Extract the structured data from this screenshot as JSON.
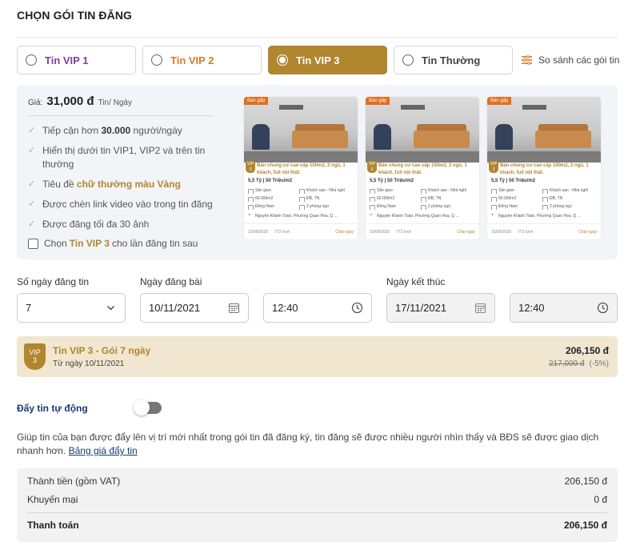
{
  "page": {
    "title": "CHỌN GÓI TIN ĐĂNG"
  },
  "tabs": [
    {
      "label": "Tin VIP 1",
      "color": "#7b3f98",
      "selected": false
    },
    {
      "label": "Tin VIP 2",
      "color": "#d9792e",
      "selected": false
    },
    {
      "label": "Tin VIP 3",
      "color": "#ffffff",
      "selected": true
    },
    {
      "label": "Tin Thường",
      "color": "#444444",
      "selected": false
    }
  ],
  "compare": {
    "label": "So sánh các gói tin",
    "icon": "sliders-icon"
  },
  "info": {
    "price_label": "Giá:",
    "price": "31,000 đ",
    "price_unit": "Tin/ Ngày",
    "features": [
      {
        "pre": "Tiếp cận hơn ",
        "bold": "30.000",
        "post": " người/ngày",
        "style": "bold"
      },
      {
        "pre": "Hiển thị dưới tin VIP1, VIP2 và trên tin thường",
        "bold": "",
        "post": "",
        "style": "plain"
      },
      {
        "pre": "Tiêu đề ",
        "bold": "chữ thường màu Vàng",
        "post": "",
        "style": "gold"
      },
      {
        "pre": "Được chèn link video vào trong tin đăng",
        "bold": "",
        "post": "",
        "style": "plain"
      },
      {
        "pre": "Được đăng tối đa 30 ảnh",
        "bold": "",
        "post": "",
        "style": "plain"
      }
    ],
    "next_time": {
      "pre": "Chọn",
      "gold": "Tin VIP 3",
      "post": "cho lần đăng tin sau",
      "checked": false
    }
  },
  "preview_card": {
    "badge": "Bán gấp",
    "vip_tag": "VIP 3",
    "title": "Bán chung cư cao cấp 100m2, 2 ngủ, 1 khách, full nội thất.",
    "price": "5,5 Tỷ  |  50 Triệu/m2",
    "specs": [
      "Sân giao",
      "Khách sạn - Nhà nghỉ",
      "60.000m2",
      "ĐB, TN",
      "Đông Nam",
      "2 phòng ngủ"
    ],
    "address": "Nguyễn Khánh Toàn, Phường Quan Hoa, Q ...",
    "date": "15/09/2020",
    "views": "772 lượt",
    "chat": "Chat ngay"
  },
  "fields": {
    "days_label": "Số ngày đăng tin",
    "days_value": "7",
    "start_label": "Ngày đăng bài",
    "start_date": "10/11/2021",
    "start_time": "12:40",
    "end_label": "Ngày kết thúc",
    "end_date": "17/11/2021",
    "end_time": "12:40"
  },
  "summary": {
    "shield_top": "VIP",
    "shield_bottom": "3",
    "package": "Tin VIP 3 - Gói 7 ngày",
    "from": "Từ ngày 10/11/2021",
    "total": "206,150 đ",
    "old_price": "217,000 đ",
    "discount": "(-5%)"
  },
  "auto_push": {
    "label": "Đẩy tin tự động",
    "enabled": false,
    "description": "Giúp tin của bạn được đẩy lên vị trí mới nhất trong gói tin đã đăng ký, tin đăng sẽ được nhiều người nhìn thấy và BĐS sẽ được giao dịch nhanh hơn.",
    "link": "Bảng giá đẩy tin"
  },
  "payment": {
    "subtotal_label": "Thành tiền (gồm VAT)",
    "subtotal": "206,150 đ",
    "promo_label": "Khuyến mại",
    "promo": "0 đ",
    "total_label": "Thanh toán",
    "total": "206,150 đ"
  },
  "colors": {
    "gold": "#b0862f",
    "gold_light": "#f1e6d0",
    "navy": "#1a3a6e",
    "panel": "#f2f4f7"
  }
}
